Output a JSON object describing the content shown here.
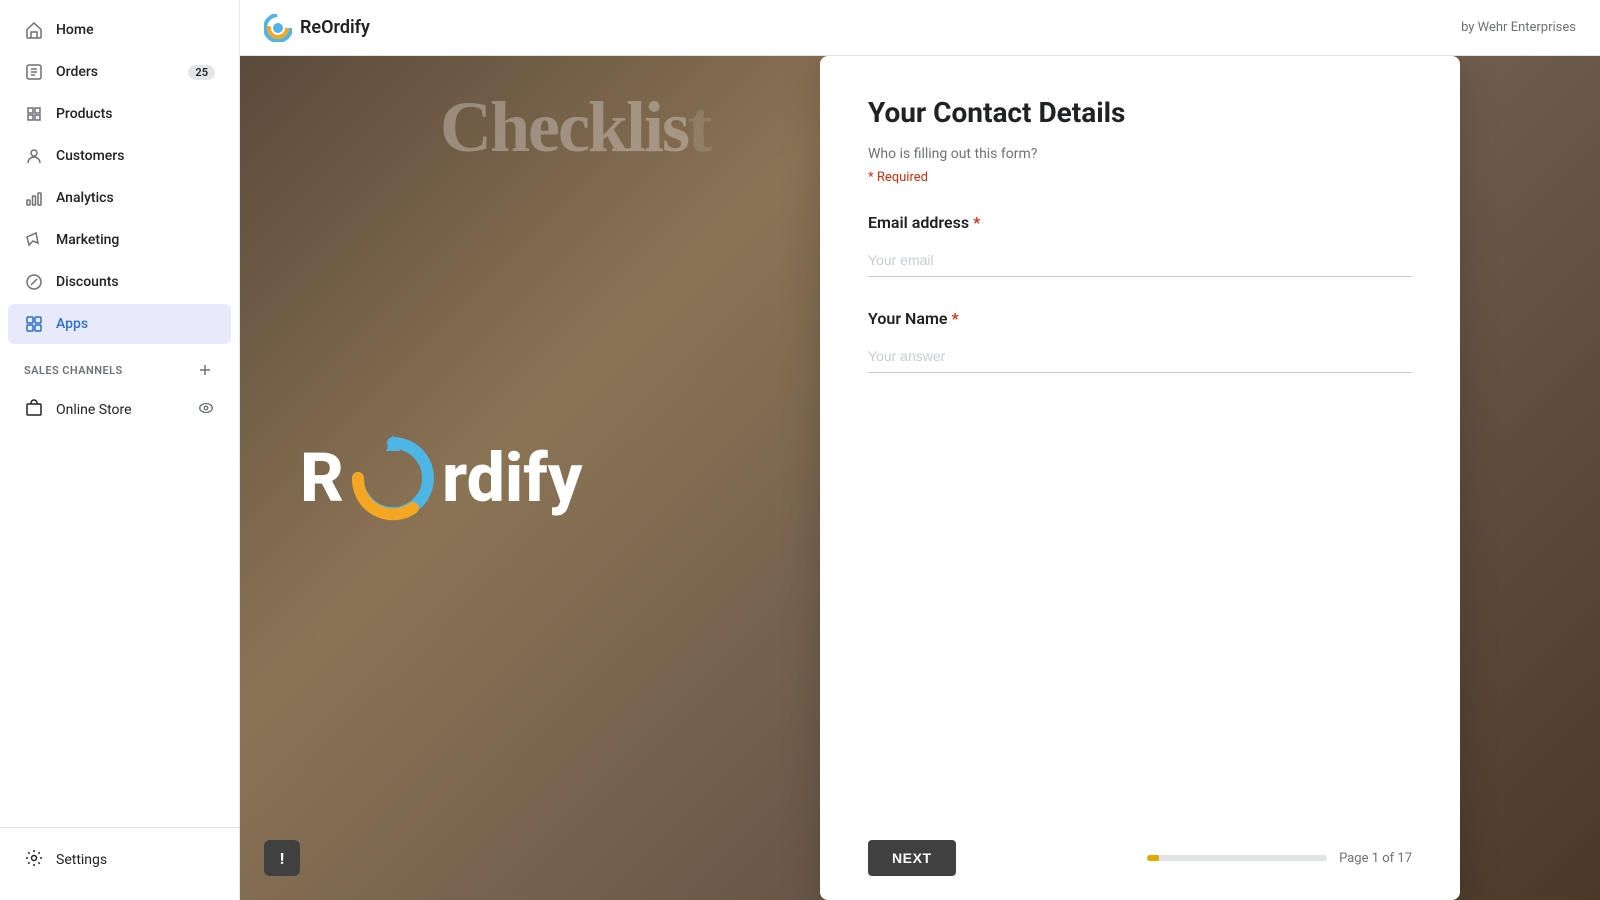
{
  "topbar": {
    "logo_text": "ReOrdify",
    "byline": "by Wehr Enterprises",
    "logo_icon": "reordify-logo"
  },
  "sidebar": {
    "nav_items": [
      {
        "id": "home",
        "label": "Home",
        "icon": "home-icon",
        "badge": null,
        "active": false
      },
      {
        "id": "orders",
        "label": "Orders",
        "icon": "orders-icon",
        "badge": "25",
        "active": false
      },
      {
        "id": "products",
        "label": "Products",
        "icon": "products-icon",
        "badge": null,
        "active": false
      },
      {
        "id": "customers",
        "label": "Customers",
        "icon": "customers-icon",
        "badge": null,
        "active": false
      },
      {
        "id": "analytics",
        "label": "Analytics",
        "icon": "analytics-icon",
        "badge": null,
        "active": false
      },
      {
        "id": "marketing",
        "label": "Marketing",
        "icon": "marketing-icon",
        "badge": null,
        "active": false
      },
      {
        "id": "discounts",
        "label": "Discounts",
        "icon": "discounts-icon",
        "badge": null,
        "active": false
      },
      {
        "id": "apps",
        "label": "Apps",
        "icon": "apps-icon",
        "badge": null,
        "active": true
      }
    ],
    "sales_channels_label": "SALES CHANNELS",
    "online_store_label": "Online Store",
    "settings_label": "Settings"
  },
  "hero": {
    "checklist_text": "Checklis",
    "brand_text_before": "R",
    "brand_text_after": "ordify"
  },
  "modal": {
    "title": "Your Contact Details",
    "subtitle": "Who is filling out this form?",
    "required_text": "* Required",
    "email_label": "Email address",
    "email_placeholder": "Your email",
    "name_label": "Your Name",
    "name_placeholder": "Your answer",
    "next_button": "NEXT",
    "page_indicator": "Page 1 of 17",
    "progress_percent": 5.88
  },
  "feedback": {
    "icon": "!"
  }
}
